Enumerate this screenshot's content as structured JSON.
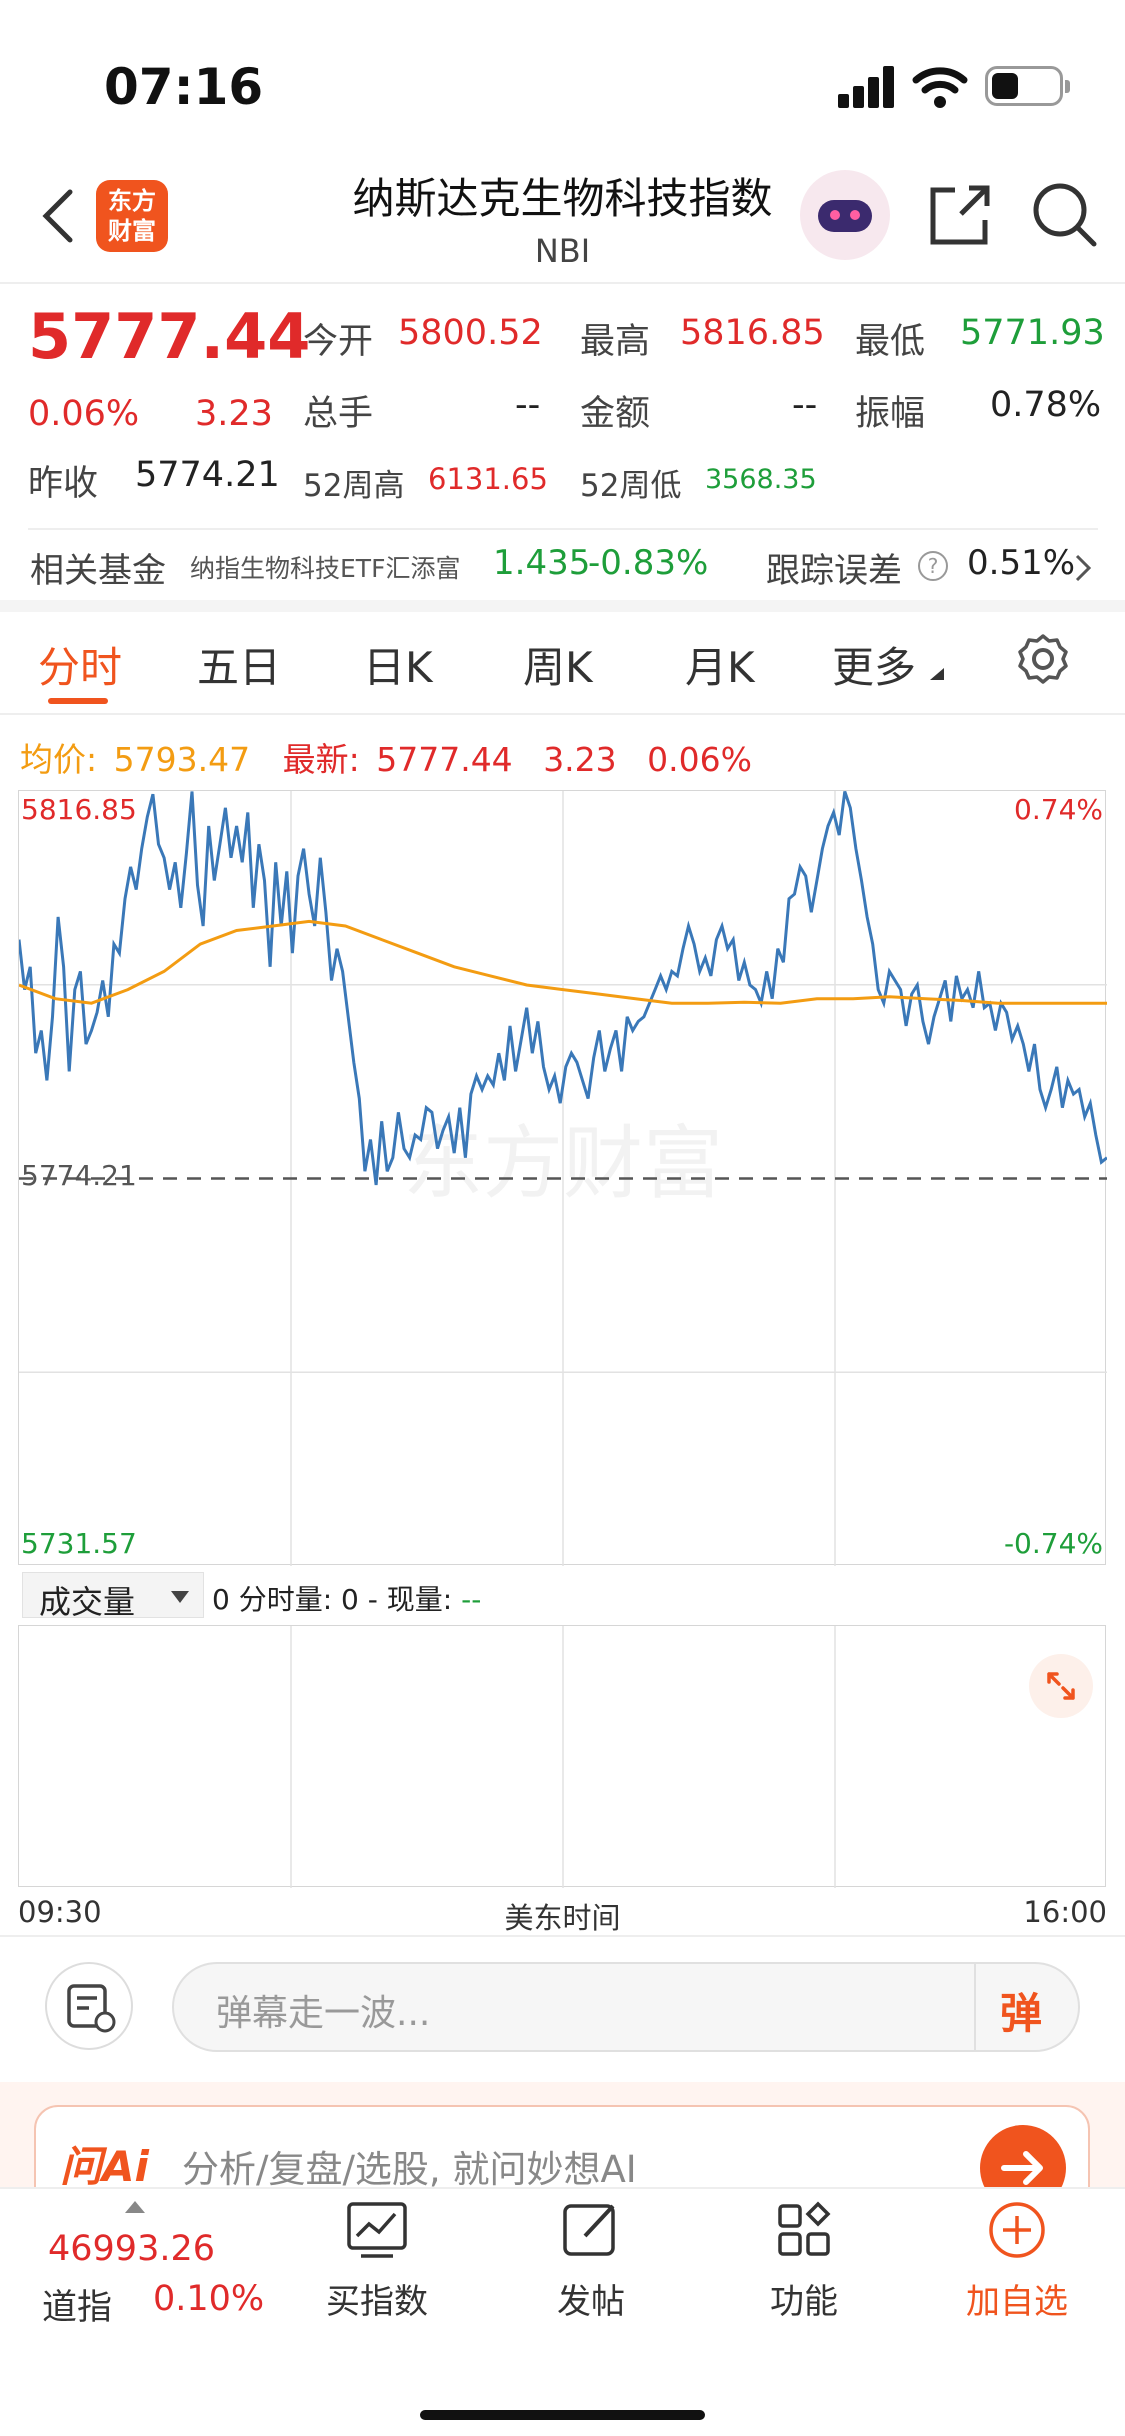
{
  "status": {
    "time": "07:16"
  },
  "header": {
    "logo_text": "东方\n财富",
    "title": "纳斯达克生物科技指数",
    "code": "NBI"
  },
  "quote": {
    "price": "5777.44",
    "change_pct": "0.06%",
    "change": "3.23",
    "prev_close_label": "昨收",
    "prev_close": "5774.21",
    "open_label": "今开",
    "open": "5800.52",
    "high_label": "最高",
    "high": "5816.85",
    "low_label": "最低",
    "low": "5771.93",
    "volume_label": "总手",
    "volume": "--",
    "amount_label": "金额",
    "amount": "--",
    "amplitude_label": "振幅",
    "amplitude": "0.78%",
    "wk52_high_label": "52周高",
    "wk52_high": "6131.65",
    "wk52_low_label": "52周低",
    "wk52_low": "3568.35"
  },
  "fund": {
    "label": "相关基金",
    "name": "纳指生物科技ETF汇添富",
    "price": "1.435",
    "change": "-0.83%",
    "tracking_label": "跟踪误差",
    "tracking": "0.51%"
  },
  "tabs": [
    "分时",
    "五日",
    "日K",
    "周K",
    "月K",
    "更多"
  ],
  "legend": {
    "avg_label": "均价:",
    "avg": "5793.47",
    "latest_label": "最新:",
    "latest": "5777.44",
    "change": "3.23",
    "change_pct": "0.06%"
  },
  "axis": {
    "top_left": "5816.85",
    "top_right": "0.74%",
    "mid_left": "5774.21",
    "bottom_left": "5731.57",
    "bottom_right": "-0.74%",
    "x_start": "09:30",
    "x_mid": "美东时间",
    "x_end": "16:00"
  },
  "watermark": "东方财富",
  "volume_panel": {
    "selector": "成交量",
    "info_prefix": "0 分时量: 0 - 现量:",
    "info_value": "--"
  },
  "comment": {
    "placeholder": "弹幕走一波...",
    "danmu": "弹"
  },
  "ai_bar": {
    "brand": "问Ai",
    "placeholder": "分析/复盘/选股, 就问妙想AI"
  },
  "bottom_nav": {
    "index_value": "46993.26",
    "index_name": "道指",
    "index_change": "0.10%",
    "items": [
      "买指数",
      "发帖",
      "功能",
      "加自选"
    ]
  },
  "colors": {
    "up": "#e02a2a",
    "down": "#1e9e3a",
    "price_line": "#3a78b8",
    "avg_line": "#f39c12",
    "brand": "#f0541e"
  },
  "chart_data": {
    "type": "line",
    "x_range": [
      "09:30",
      "16:00"
    ],
    "ylim": [
      5731.57,
      5816.85
    ],
    "reference": 5774.21,
    "series": [
      {
        "name": "价格",
        "values": [
          5800.5,
          5795.0,
          5797.5,
          5788.0,
          5790.5,
          5785.0,
          5792.0,
          5803.0,
          5797.5,
          5786.0,
          5795.0,
          5797.0,
          5789.0,
          5790.5,
          5792.5,
          5796.0,
          5792.0,
          5800.0,
          5799.0,
          5805.0,
          5808.5,
          5806.0,
          5810.5,
          5814.0,
          5816.5,
          5811.0,
          5809.5,
          5806.0,
          5809.0,
          5804.0,
          5810.0,
          5816.8,
          5806.5,
          5802.0,
          5813.0,
          5807.0,
          5811.0,
          5815.0,
          5809.5,
          5813.0,
          5809.0,
          5814.5,
          5804.0,
          5811.0,
          5807.0,
          5797.5,
          5809.0,
          5802.0,
          5808.0,
          5799.0,
          5807.5,
          5810.5,
          5805.5,
          5802.0,
          5809.5,
          5803.5,
          5796.0,
          5799.5,
          5797.0,
          5792.0,
          5787.0,
          5783.0,
          5775.0,
          5778.5,
          5773.5,
          5780.5,
          5775.0,
          5776.5,
          5781.5,
          5777.5,
          5776.5,
          5779.0,
          5778.5,
          5782.0,
          5781.5,
          5777.5,
          5779.5,
          5781.0,
          5777.0,
          5782.0,
          5776.5,
          5783.5,
          5785.5,
          5784.0,
          5785.5,
          5784.5,
          5788.0,
          5785.0,
          5791.0,
          5786.0,
          5789.5,
          5793.0,
          5788.0,
          5791.5,
          5786.5,
          5784.0,
          5785.5,
          5782.5,
          5786.5,
          5788.0,
          5787.0,
          5785.0,
          5783.0,
          5787.5,
          5790.5,
          5786.0,
          5788.5,
          5790.5,
          5786.0,
          5792.0,
          5790.5,
          5791.5,
          5792.0,
          5793.5,
          5795.0,
          5796.5,
          5795.0,
          5797.0,
          5796.5,
          5799.5,
          5802.0,
          5800.0,
          5797.0,
          5798.5,
          5796.5,
          5800.5,
          5802.0,
          5799.5,
          5800.5,
          5796.0,
          5798.0,
          5795.5,
          5795.0,
          5793.5,
          5797.0,
          5794.0,
          5799.5,
          5798.0,
          5805.0,
          5805.5,
          5808.5,
          5807.5,
          5803.5,
          5807.0,
          5810.5,
          5813.0,
          5814.5,
          5812.0,
          5816.8,
          5815.0,
          5810.5,
          5807.0,
          5803.0,
          5800.0,
          5795.0,
          5793.5,
          5797.0,
          5796.0,
          5795.0,
          5791.0,
          5794.5,
          5795.5,
          5791.5,
          5789.0,
          5792.0,
          5794.0,
          5796.0,
          5791.5,
          5796.5,
          5794.0,
          5795.0,
          5793.0,
          5797.0,
          5793.0,
          5793.5,
          5790.5,
          5793.5,
          5792.5,
          5789.5,
          5791.0,
          5789.0,
          5786.0,
          5789.0,
          5784.0,
          5782.0,
          5784.0,
          5786.5,
          5782.0,
          5785.0,
          5783.5,
          5784.0,
          5781.0,
          5782.5,
          5779.0,
          5776.0,
          5776.5
        ]
      },
      {
        "name": "均价",
        "values": [
          5795.5,
          5794.0,
          5793.5,
          5795.0,
          5797.0,
          5800.0,
          5801.5,
          5802.0,
          5802.5,
          5802.0,
          5800.5,
          5799.0,
          5797.5,
          5796.5,
          5795.5,
          5795.0,
          5794.5,
          5794.0,
          5793.5,
          5793.5,
          5793.6,
          5793.5,
          5794.0,
          5794.0,
          5794.2,
          5794.0,
          5793.8,
          5793.5,
          5793.5,
          5793.5,
          5793.5
        ]
      }
    ]
  }
}
